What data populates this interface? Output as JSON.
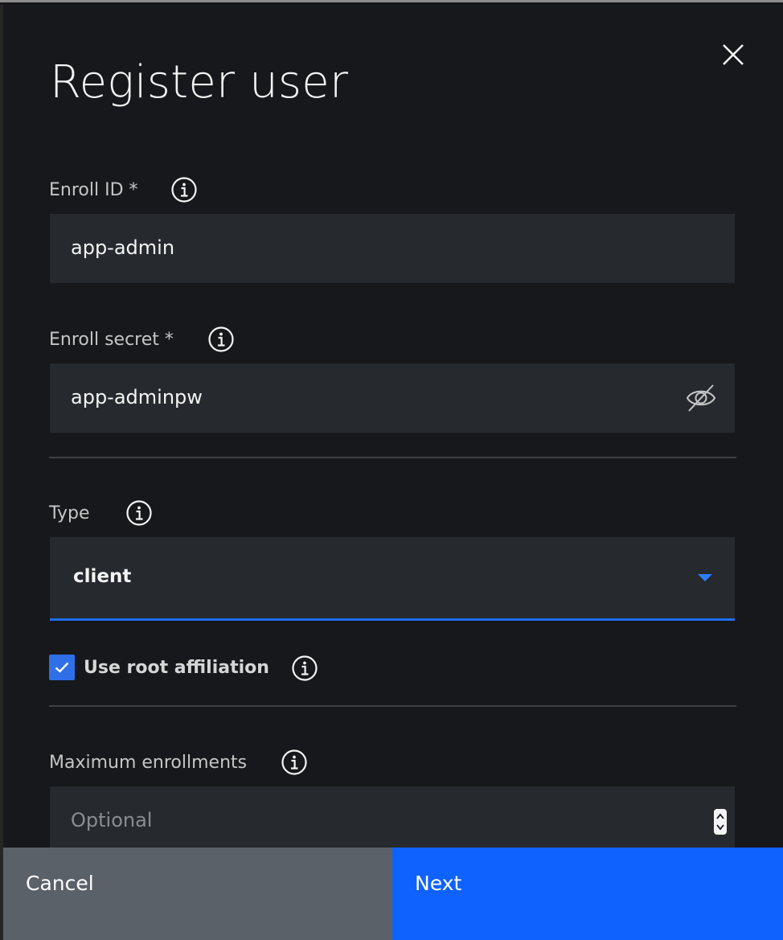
{
  "modal": {
    "title": "Register user",
    "close_icon": "close-icon"
  },
  "fields": {
    "enroll_id": {
      "label": "Enroll ID *",
      "value": "app-admin"
    },
    "enroll_secret": {
      "label": "Enroll secret *",
      "value": "app-adminpw",
      "toggle_icon": "eye-slash-icon"
    },
    "type": {
      "label": "Type",
      "selected": "client"
    },
    "root_affiliation": {
      "label": "Use root affiliation",
      "checked": true
    },
    "max_enrollments": {
      "label": "Maximum enrollments",
      "placeholder": "Optional"
    }
  },
  "footer": {
    "cancel_label": "Cancel",
    "next_label": "Next"
  },
  "colors": {
    "primary": "#0f62fe",
    "secondary": "#5b6168",
    "field_bg": "#262a2e",
    "modal_bg": "#16181b"
  }
}
